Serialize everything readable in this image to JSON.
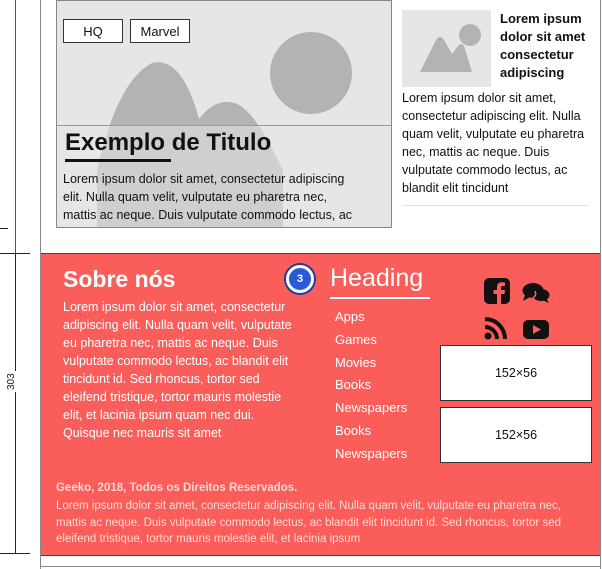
{
  "ruler": {
    "label": "303"
  },
  "card": {
    "tags": [
      "HQ",
      "Marvel"
    ],
    "title": "Exemplo de Titulo",
    "text": [
      "Lorem ipsum dolor sit amet, consectetur adipiscing",
      "elit. Nulla quam velit, vulputate eu pharetra nec,",
      "mattis ac neque. Duis vulputate commodo lectus, ac"
    ]
  },
  "side_article": {
    "title": "Lorem ipsum dolor sit amet consectetur adipiscing",
    "text": "Lorem ipsum dolor sit amet, consectetur adipiscing elit. Nulla quam velit, vulputate eu pharetra nec, mattis ac neque. Duis vulputate commodo lectus, ac blandit elit tincidunt"
  },
  "footer": {
    "about_title": "Sobre nós",
    "about_text": "Lorem ipsum dolor sit amet, consectetur adipiscing elit. Nulla quam velit, vulputate eu pharetra nec, mattis ac neque. Duis vulputate commodo lectus, ac blandit elit tincidunt id. Sed rhoncus, tortor sed eleifend tristique, tortor mauris molestie elit, et lacinia ipsum quam nec dui. Quisque nec mauris sit amet",
    "badge": "3",
    "heading": "Heading",
    "links": [
      "Apps",
      "Games",
      "Movies",
      "Books",
      "Newspapers",
      "Books",
      "Newspapers"
    ],
    "social_icons": [
      "facebook-icon",
      "chat-bubbles-icon",
      "rss-icon",
      "youtube-icon"
    ],
    "ads": [
      "152×56",
      "152×56"
    ],
    "copyright": "Geeko, 2018, Todos os Direitos Reservados.",
    "legal": "Lorem ipsum dolor sit amet, consectetur adipiscing elit. Nulla quam velit, vulputate eu pharetra nec, mattis ac neque. Duis vulputate commodo lectus, ac blandit elit tincidunt id. Sed rhoncus, tortor sed eleifend tristique, tortor mauris molestie elit, et lacinia ipsum"
  },
  "colors": {
    "footer_bg": "#fa5d5a",
    "badge": "#2a5bd7",
    "placeholder": "#e6e6e6"
  }
}
